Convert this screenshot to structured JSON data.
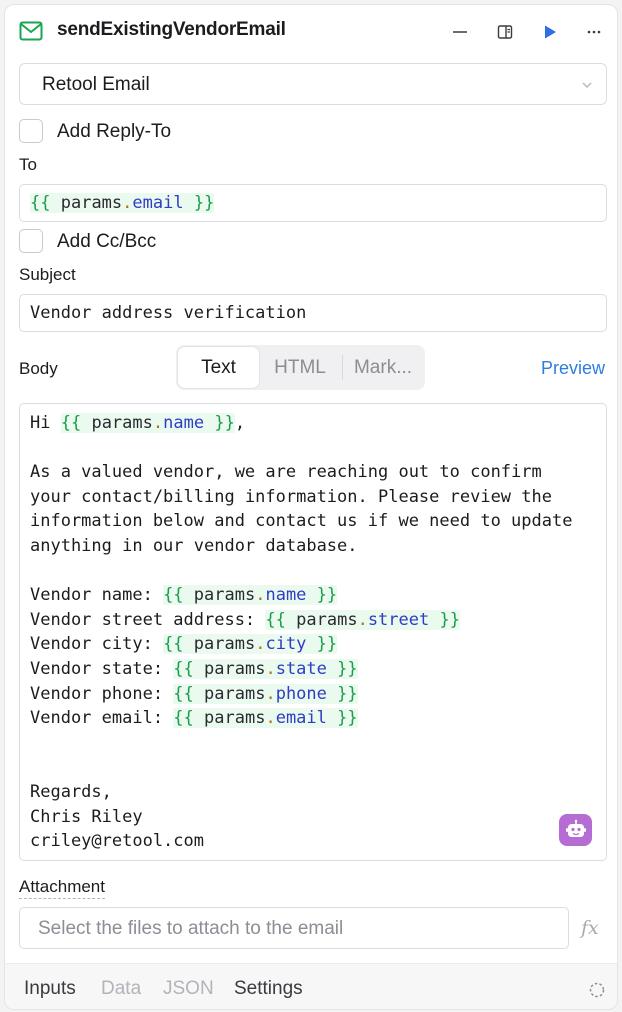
{
  "header": {
    "title": "sendExistingVendorEmail",
    "icons": [
      "envelope-icon",
      "minimize-icon",
      "sidebar-toggle-icon",
      "run-play-icon",
      "more-options-icon"
    ],
    "accent_color": "#1aa551",
    "run_color": "#2f6fe4"
  },
  "resource": {
    "selected": "Retool Email"
  },
  "reply_to": {
    "label": "Add Reply-To",
    "checked": false
  },
  "to": {
    "label": "To",
    "value": {
      "open": "{{",
      "obj": "params",
      "dot": ".",
      "key": "email",
      "close": "}}"
    }
  },
  "cc_bcc": {
    "label": "Add Cc/Bcc",
    "checked": false
  },
  "subject": {
    "label": "Subject",
    "value": "Vendor address verification"
  },
  "body": {
    "label": "Body",
    "tabs": [
      "Text",
      "HTML",
      "Mark..."
    ],
    "active_tab": "Text",
    "preview_label": "Preview",
    "lines": [
      [
        {
          "t": "Hi "
        },
        {
          "tok": "name"
        },
        {
          "t": ","
        }
      ],
      [],
      [
        {
          "t": "As a valued vendor, we are reaching out to confirm"
        }
      ],
      [
        {
          "t": "your contact/billing information. Please review the"
        }
      ],
      [
        {
          "t": "information below and contact us if we need to update"
        }
      ],
      [
        {
          "t": "anything in our vendor database."
        }
      ],
      [],
      [
        {
          "t": "Vendor name: "
        },
        {
          "tok": "name"
        }
      ],
      [
        {
          "t": "Vendor street address: "
        },
        {
          "tok": "street"
        }
      ],
      [
        {
          "t": "Vendor city: "
        },
        {
          "tok": "city"
        }
      ],
      [
        {
          "t": "Vendor state: "
        },
        {
          "tok": "state"
        }
      ],
      [
        {
          "t": "Vendor phone: "
        },
        {
          "tok": "phone"
        }
      ],
      [
        {
          "t": "Vendor email: "
        },
        {
          "tok": "email"
        }
      ],
      [],
      [],
      [
        {
          "t": "Regards,"
        }
      ],
      [
        {
          "t": "Chris Riley"
        }
      ],
      [
        {
          "t": "criley@retool.com"
        }
      ]
    ],
    "token_object": "params",
    "assistant_icon": "robot-icon"
  },
  "attachment": {
    "label": "Attachment",
    "placeholder": "Select the files to attach to the email",
    "fx_label": "fx"
  },
  "bottom_tabs": [
    {
      "label": "Inputs",
      "active": true
    },
    {
      "label": "Data",
      "active": false
    },
    {
      "label": "JSON",
      "active": false
    },
    {
      "label": "Settings",
      "active": true
    }
  ]
}
